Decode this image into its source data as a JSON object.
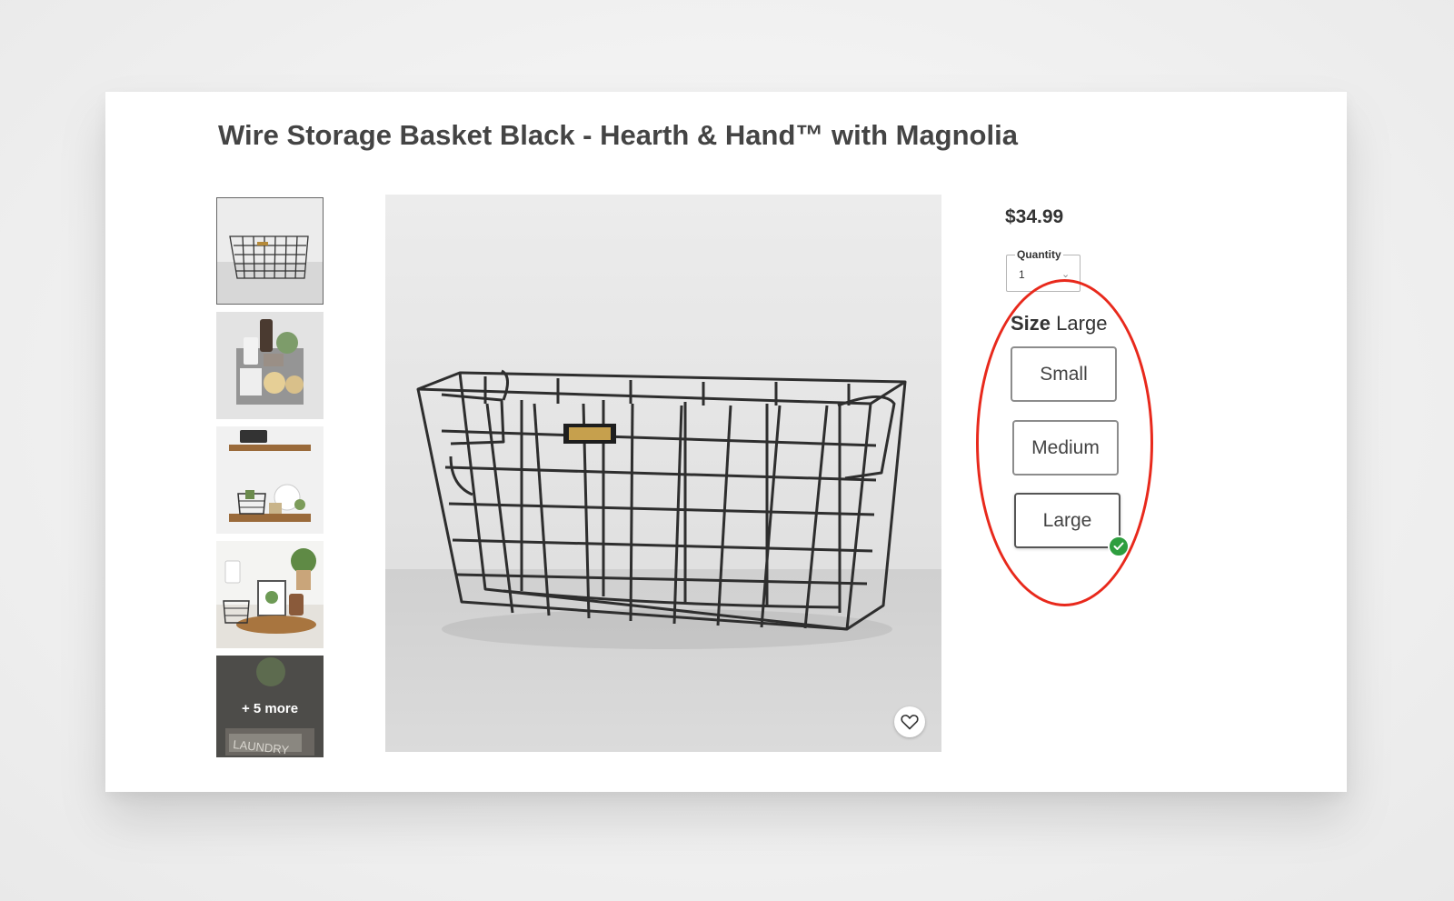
{
  "product": {
    "title": "Wire Storage Basket Black - Hearth & Hand™ with Magnolia",
    "price": "$34.99"
  },
  "gallery": {
    "more_label": "+ 5 more",
    "thumbnails": [
      {
        "name": "basket-photo",
        "selected": true
      },
      {
        "name": "basket-with-toiletries"
      },
      {
        "name": "basket-on-shelf"
      },
      {
        "name": "basket-on-counter"
      },
      {
        "name": "laundry-basket"
      }
    ]
  },
  "quantity": {
    "label": "Quantity",
    "value": "1",
    "caret_icon": "chevron-down-icon"
  },
  "size": {
    "label": "Size",
    "selected": "Large",
    "options": [
      {
        "label": "Small"
      },
      {
        "label": "Medium"
      },
      {
        "label": "Large",
        "selected": true
      }
    ]
  },
  "icons": {
    "favorite": "heart-outline-icon",
    "selected": "check-icon"
  },
  "colors": {
    "annotation": "#e8291c",
    "selected_check": "#2e9e3f",
    "title": "#444444"
  }
}
